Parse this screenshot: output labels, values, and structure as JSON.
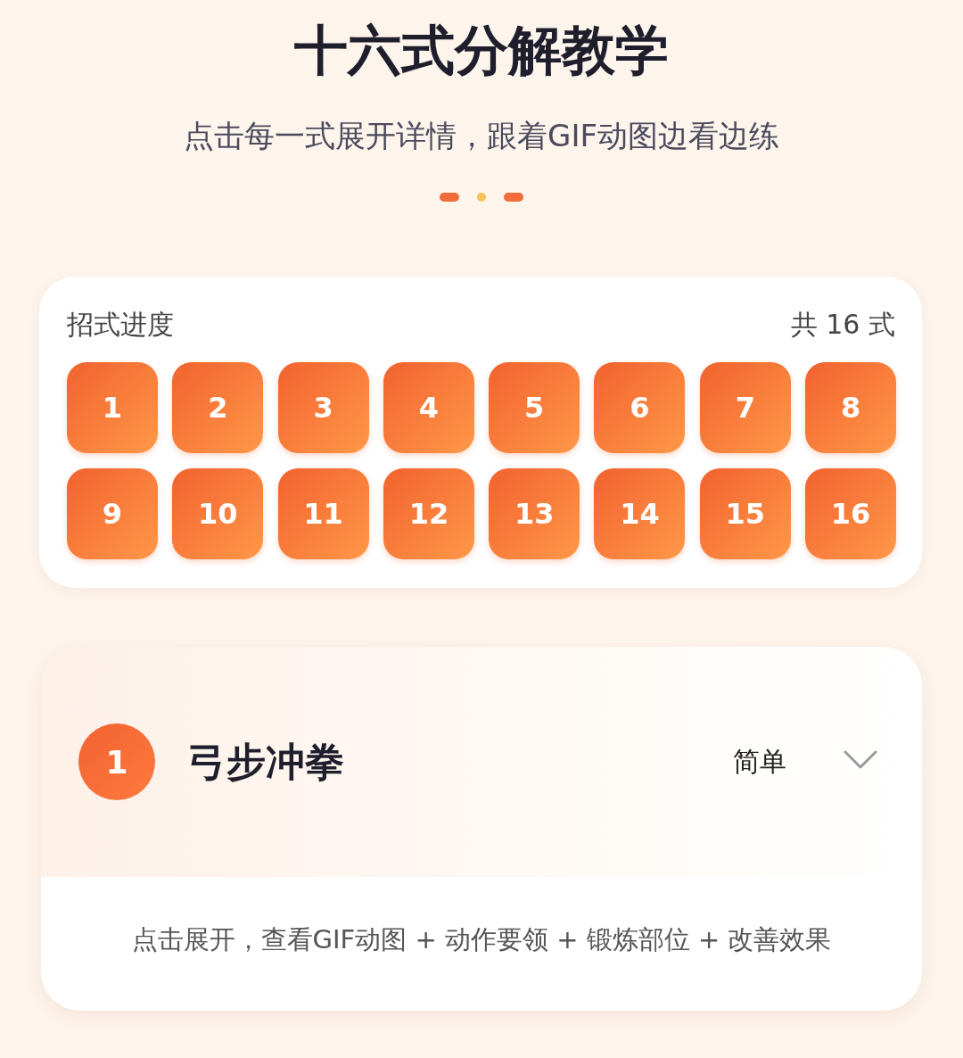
{
  "header": {
    "title": "十六式分解教学",
    "subtitle": "点击每一式展开详情，跟着GIF动图边看边练"
  },
  "dots": [
    {
      "kind": "pill",
      "color": "#f26b3a"
    },
    {
      "kind": "dot",
      "color": "#f7c35a"
    },
    {
      "kind": "pill",
      "color": "#f26b3a"
    }
  ],
  "progress": {
    "label": "招式进度",
    "total": "共 16 式",
    "moves": [
      "1",
      "2",
      "3",
      "4",
      "5",
      "6",
      "7",
      "8",
      "9",
      "10",
      "11",
      "12",
      "13",
      "14",
      "15",
      "16"
    ]
  },
  "exercise": {
    "number": "1",
    "name": "弓步冲拳",
    "difficulty": "简单",
    "expanded": false,
    "hint": "点击展开，查看GIF动图 + 动作要领 + 锻炼部位 + 改善效果"
  }
}
